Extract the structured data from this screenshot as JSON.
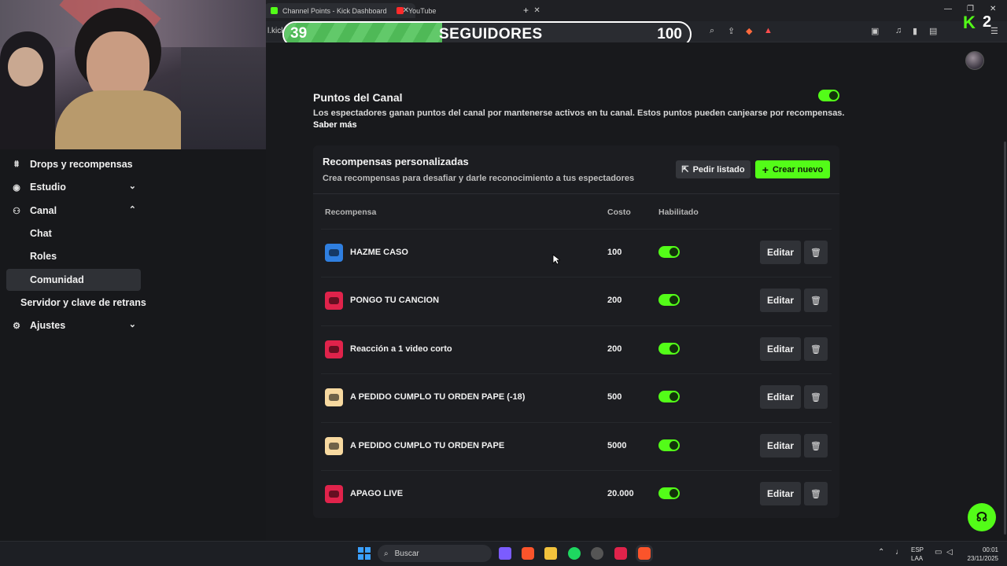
{
  "browser": {
    "tabs": [
      {
        "label": "Channel Points - Kick Dashboard",
        "active": true
      },
      {
        "label": "YouTube",
        "active": false
      }
    ],
    "new_tab": "+",
    "url_fragment": "l.kick.",
    "window_controls": [
      "—",
      "❐",
      "✕"
    ]
  },
  "overlay": {
    "follow_current": "39",
    "follow_label": "SEGUIDORES",
    "follow_goal": "100",
    "follow_progress": 0.39,
    "kick_badge": "K",
    "kick_count": "2"
  },
  "sidebar": {
    "items": [
      {
        "label": "Drops y recompensas",
        "icon": "gift-icon"
      },
      {
        "label": "Estudio",
        "icon": "studio-icon",
        "chevron": "down"
      },
      {
        "label": "Canal",
        "icon": "channel-icon",
        "chevron": "up"
      },
      {
        "label": "Chat",
        "sub": true
      },
      {
        "label": "Roles",
        "sub": true
      },
      {
        "label": "Comunidad",
        "sub": true,
        "active": true
      },
      {
        "label": "Servidor y clave de retrans",
        "sub_partial": true
      },
      {
        "label": "Ajustes",
        "icon": "gear-icon",
        "chevron": "down"
      }
    ]
  },
  "channel_points": {
    "title": "Puntos del Canal",
    "description": "Los espectadores ganan puntos del canal por mantenerse activos en tu canal. Estos puntos pueden canjearse por recompensas.",
    "learn_more": "Saber más",
    "enabled": true
  },
  "custom_rewards": {
    "title": "Recompensas personalizadas",
    "subtitle": "Crea recompensas para desafiar y darle reconocimiento a tus espectadores",
    "list_button": "Pedir listado",
    "create_button": "Crear nuevo",
    "columns": {
      "reward": "Recompensa",
      "cost": "Costo",
      "enabled": "Habilitado"
    },
    "edit_label": "Editar",
    "rows": [
      {
        "name": "HAZME CASO",
        "cost": "100",
        "enabled": true,
        "color": "#2f7fe0"
      },
      {
        "name": "PONGO TU CANCION",
        "cost": "200",
        "enabled": true,
        "color": "#e0234b"
      },
      {
        "name": "Reacción a 1 video corto",
        "cost": "200",
        "enabled": true,
        "color": "#e0234b"
      },
      {
        "name": "A PEDIDO CUMPLO TU ORDEN PAPE (-18)",
        "cost": "500",
        "enabled": true,
        "color": "#f7d9a0"
      },
      {
        "name": "A PEDIDO CUMPLO TU ORDEN PAPE",
        "cost": "5000",
        "enabled": true,
        "color": "#f7d9a0"
      },
      {
        "name": "APAGO LIVE",
        "cost": "20.000",
        "enabled": true,
        "color": "#e0234b"
      }
    ]
  },
  "taskbar": {
    "search_placeholder": "Buscar",
    "lang_top": "ESP",
    "lang_bottom": "LAA",
    "time": "00:01",
    "date": "23/11/2025"
  },
  "colors": {
    "accent": "#53fc18",
    "background": "#17181b",
    "card": "#1c1d21"
  }
}
